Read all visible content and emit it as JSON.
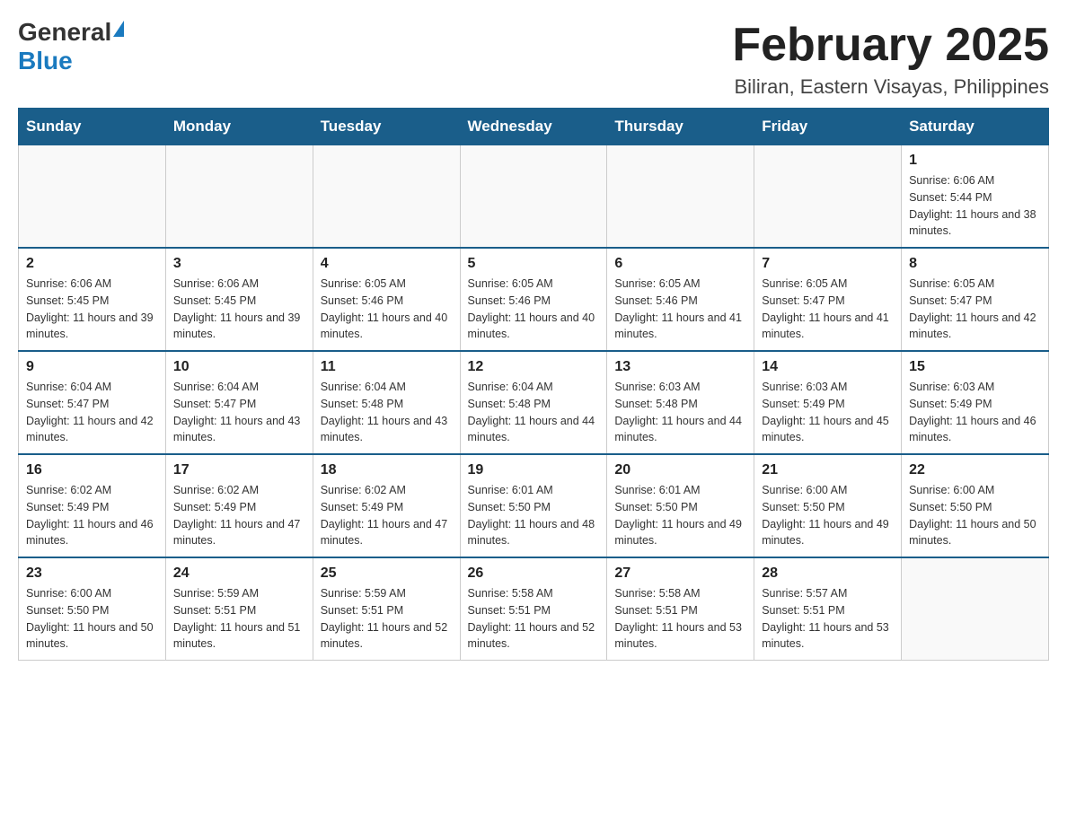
{
  "logo": {
    "general": "General",
    "blue": "Blue"
  },
  "title": "February 2025",
  "subtitle": "Biliran, Eastern Visayas, Philippines",
  "days_of_week": [
    "Sunday",
    "Monday",
    "Tuesday",
    "Wednesday",
    "Thursday",
    "Friday",
    "Saturday"
  ],
  "weeks": [
    [
      {
        "day": "",
        "info": ""
      },
      {
        "day": "",
        "info": ""
      },
      {
        "day": "",
        "info": ""
      },
      {
        "day": "",
        "info": ""
      },
      {
        "day": "",
        "info": ""
      },
      {
        "day": "",
        "info": ""
      },
      {
        "day": "1",
        "info": "Sunrise: 6:06 AM\nSunset: 5:44 PM\nDaylight: 11 hours and 38 minutes."
      }
    ],
    [
      {
        "day": "2",
        "info": "Sunrise: 6:06 AM\nSunset: 5:45 PM\nDaylight: 11 hours and 39 minutes."
      },
      {
        "day": "3",
        "info": "Sunrise: 6:06 AM\nSunset: 5:45 PM\nDaylight: 11 hours and 39 minutes."
      },
      {
        "day": "4",
        "info": "Sunrise: 6:05 AM\nSunset: 5:46 PM\nDaylight: 11 hours and 40 minutes."
      },
      {
        "day": "5",
        "info": "Sunrise: 6:05 AM\nSunset: 5:46 PM\nDaylight: 11 hours and 40 minutes."
      },
      {
        "day": "6",
        "info": "Sunrise: 6:05 AM\nSunset: 5:46 PM\nDaylight: 11 hours and 41 minutes."
      },
      {
        "day": "7",
        "info": "Sunrise: 6:05 AM\nSunset: 5:47 PM\nDaylight: 11 hours and 41 minutes."
      },
      {
        "day": "8",
        "info": "Sunrise: 6:05 AM\nSunset: 5:47 PM\nDaylight: 11 hours and 42 minutes."
      }
    ],
    [
      {
        "day": "9",
        "info": "Sunrise: 6:04 AM\nSunset: 5:47 PM\nDaylight: 11 hours and 42 minutes."
      },
      {
        "day": "10",
        "info": "Sunrise: 6:04 AM\nSunset: 5:47 PM\nDaylight: 11 hours and 43 minutes."
      },
      {
        "day": "11",
        "info": "Sunrise: 6:04 AM\nSunset: 5:48 PM\nDaylight: 11 hours and 43 minutes."
      },
      {
        "day": "12",
        "info": "Sunrise: 6:04 AM\nSunset: 5:48 PM\nDaylight: 11 hours and 44 minutes."
      },
      {
        "day": "13",
        "info": "Sunrise: 6:03 AM\nSunset: 5:48 PM\nDaylight: 11 hours and 44 minutes."
      },
      {
        "day": "14",
        "info": "Sunrise: 6:03 AM\nSunset: 5:49 PM\nDaylight: 11 hours and 45 minutes."
      },
      {
        "day": "15",
        "info": "Sunrise: 6:03 AM\nSunset: 5:49 PM\nDaylight: 11 hours and 46 minutes."
      }
    ],
    [
      {
        "day": "16",
        "info": "Sunrise: 6:02 AM\nSunset: 5:49 PM\nDaylight: 11 hours and 46 minutes."
      },
      {
        "day": "17",
        "info": "Sunrise: 6:02 AM\nSunset: 5:49 PM\nDaylight: 11 hours and 47 minutes."
      },
      {
        "day": "18",
        "info": "Sunrise: 6:02 AM\nSunset: 5:49 PM\nDaylight: 11 hours and 47 minutes."
      },
      {
        "day": "19",
        "info": "Sunrise: 6:01 AM\nSunset: 5:50 PM\nDaylight: 11 hours and 48 minutes."
      },
      {
        "day": "20",
        "info": "Sunrise: 6:01 AM\nSunset: 5:50 PM\nDaylight: 11 hours and 49 minutes."
      },
      {
        "day": "21",
        "info": "Sunrise: 6:00 AM\nSunset: 5:50 PM\nDaylight: 11 hours and 49 minutes."
      },
      {
        "day": "22",
        "info": "Sunrise: 6:00 AM\nSunset: 5:50 PM\nDaylight: 11 hours and 50 minutes."
      }
    ],
    [
      {
        "day": "23",
        "info": "Sunrise: 6:00 AM\nSunset: 5:50 PM\nDaylight: 11 hours and 50 minutes."
      },
      {
        "day": "24",
        "info": "Sunrise: 5:59 AM\nSunset: 5:51 PM\nDaylight: 11 hours and 51 minutes."
      },
      {
        "day": "25",
        "info": "Sunrise: 5:59 AM\nSunset: 5:51 PM\nDaylight: 11 hours and 52 minutes."
      },
      {
        "day": "26",
        "info": "Sunrise: 5:58 AM\nSunset: 5:51 PM\nDaylight: 11 hours and 52 minutes."
      },
      {
        "day": "27",
        "info": "Sunrise: 5:58 AM\nSunset: 5:51 PM\nDaylight: 11 hours and 53 minutes."
      },
      {
        "day": "28",
        "info": "Sunrise: 5:57 AM\nSunset: 5:51 PM\nDaylight: 11 hours and 53 minutes."
      },
      {
        "day": "",
        "info": ""
      }
    ]
  ]
}
